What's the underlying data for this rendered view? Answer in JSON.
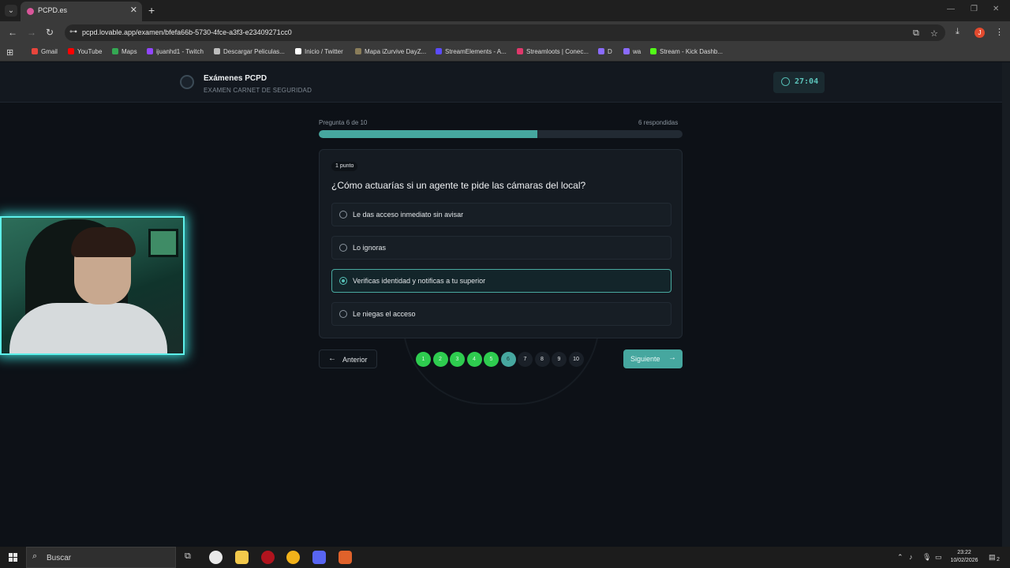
{
  "browser": {
    "tab_title": "PCPD.es",
    "url": "pcpd.lovable.app/examen/bfefa66b-5730-4fce-a3f3-e23409271cc0",
    "bookmarks": [
      {
        "label": "Gmail",
        "color": "#e8453c"
      },
      {
        "label": "YouTube",
        "color": "#ff0000"
      },
      {
        "label": "Maps",
        "color": "#34a853"
      },
      {
        "label": "ijuanhd1 - Twitch",
        "color": "#9146ff"
      },
      {
        "label": "Descargar Peliculas...",
        "color": "#bdbdbd"
      },
      {
        "label": "Inicio / Twitter",
        "color": "#ffffff"
      },
      {
        "label": "Mapa iZurvive DayZ...",
        "color": "#8a7d5a"
      },
      {
        "label": "StreamElements - A...",
        "color": "#5b4bff"
      },
      {
        "label": "Streamloots | Conec...",
        "color": "#e0386b"
      },
      {
        "label": "D",
        "color": "#8a6bff"
      },
      {
        "label": "wa",
        "color": "#8a6bff"
      },
      {
        "label": "Stream - Kick Dashb...",
        "color": "#53fc18"
      }
    ],
    "profile_initial": "J"
  },
  "header": {
    "title": "Exámenes PCPD",
    "subtitle": "EXAMEN CARNET DE SEGURIDAD",
    "timer": "27:04"
  },
  "progress": {
    "label": "Pregunta 6 de 10",
    "answered": "6 respondidas",
    "fraction": 0.6
  },
  "question": {
    "points": "1 punto",
    "text": "¿Cómo actuarías si un agente te pide las cámaras del local?",
    "options": [
      {
        "text": "Le das acceso inmediato sin avisar",
        "selected": false
      },
      {
        "text": "Lo ignoras",
        "selected": false
      },
      {
        "text": "Verificas identidad y notificas a tu superior",
        "selected": true
      },
      {
        "text": "Le niegas el acceso",
        "selected": false
      }
    ]
  },
  "navigation": {
    "prev_label": "Anterior",
    "next_label": "Siguiente",
    "questions": [
      {
        "n": "1",
        "state": "done"
      },
      {
        "n": "2",
        "state": "done"
      },
      {
        "n": "3",
        "state": "done"
      },
      {
        "n": "4",
        "state": "done"
      },
      {
        "n": "5",
        "state": "done"
      },
      {
        "n": "6",
        "state": "cur"
      },
      {
        "n": "7",
        "state": "todo"
      },
      {
        "n": "8",
        "state": "todo"
      },
      {
        "n": "9",
        "state": "todo"
      },
      {
        "n": "10",
        "state": "todo"
      }
    ]
  },
  "taskbar": {
    "search_placeholder": "Buscar",
    "time": "23:22",
    "date": "10/02/2026",
    "notification_count": "2"
  }
}
